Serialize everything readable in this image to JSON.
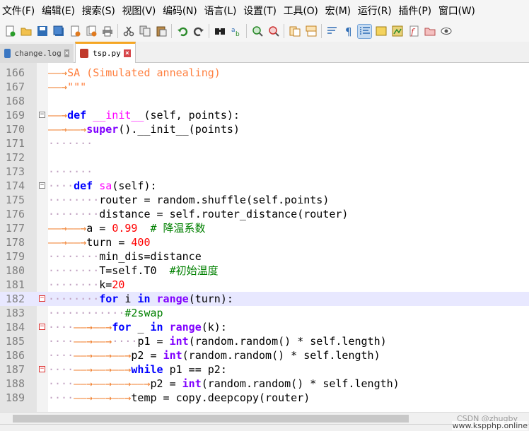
{
  "menu": [
    "文件(F)",
    "编辑(E)",
    "搜索(S)",
    "视图(V)",
    "编码(N)",
    "语言(L)",
    "设置(T)",
    "工具(O)",
    "宏(M)",
    "运行(R)",
    "插件(P)",
    "窗口(W)"
  ],
  "tabs": [
    {
      "label": "change.log",
      "active": false
    },
    {
      "label": "tsp.py",
      "active": true
    }
  ],
  "current_line": 182,
  "watermark": {
    "csdn": "CSDN @zhugby",
    "site": "www.kspphp.online"
  },
  "colors": {
    "keyword": "#0000ff",
    "function": "#ff00ff",
    "number": "#ff0000",
    "comment": "#008000",
    "string": "#ff8040",
    "tab_accent": "#f5a623"
  }
}
